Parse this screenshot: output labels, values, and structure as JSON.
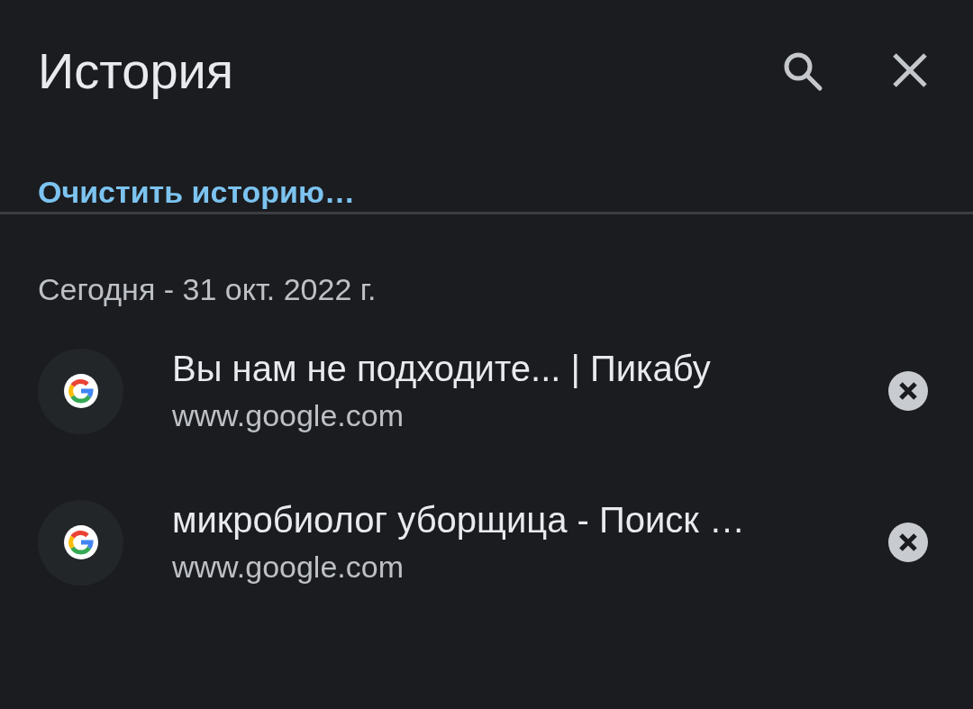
{
  "header": {
    "title": "История"
  },
  "clear_link": "Очистить историю…",
  "date_heading": "Сегодня - 31 окт. 2022 г.",
  "items": [
    {
      "title": "Вы нам не подходите... | Пикабу",
      "url": "www.google.com"
    },
    {
      "title": "микробиолог уборщица - Поиск …",
      "url": "www.google.com"
    }
  ]
}
